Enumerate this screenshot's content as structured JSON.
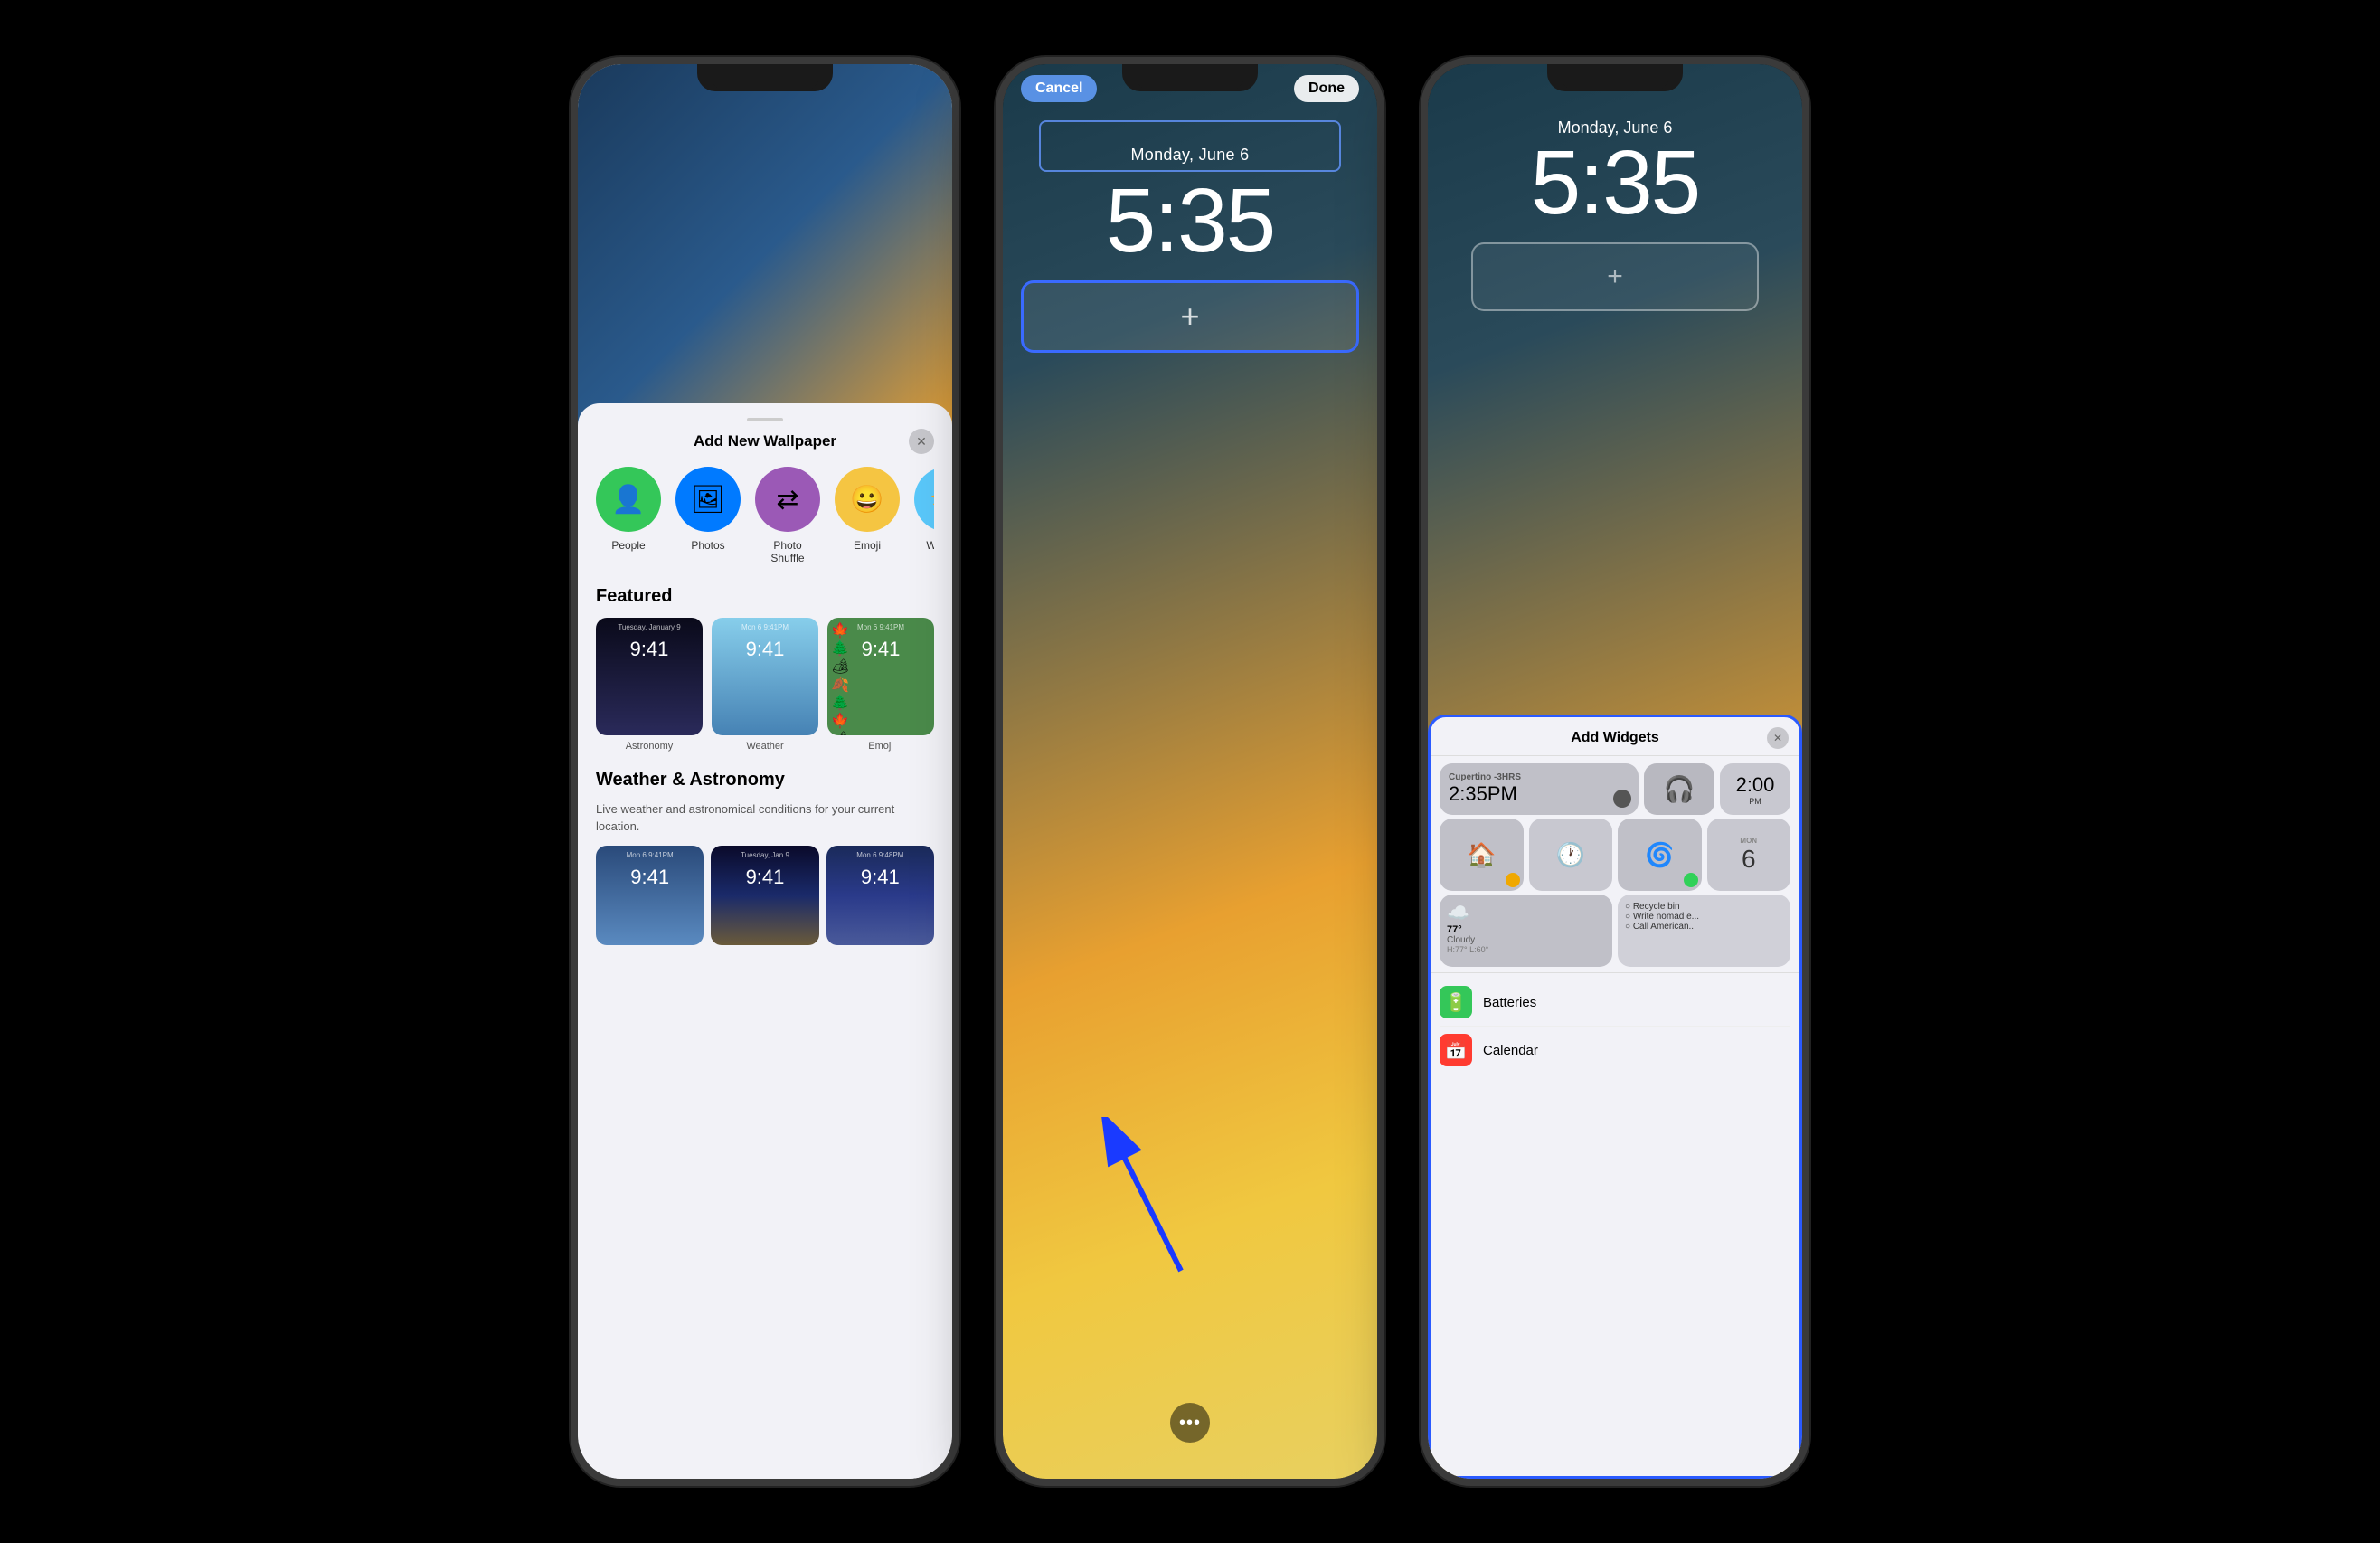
{
  "page": {
    "background": "#000000"
  },
  "phone1": {
    "sheet_title": "Add New Wallpaper",
    "close_button": "✕",
    "wallpaper_types": [
      {
        "id": "people",
        "label": "People",
        "emoji": "👤",
        "color_class": "wt-people"
      },
      {
        "id": "photos",
        "label": "Photos",
        "emoji": "🖼",
        "color_class": "wt-photos"
      },
      {
        "id": "photo_shuffle",
        "label": "Photo Shuffle",
        "emoji": "⇄",
        "color_class": "wt-photoshuffle"
      },
      {
        "id": "emoji",
        "label": "Emoji",
        "emoji": "😀",
        "color_class": "wt-emoji"
      },
      {
        "id": "weather",
        "label": "Weather",
        "emoji": "⛅",
        "color_class": "wt-weather"
      }
    ],
    "featured_label": "Featured",
    "featured_items": [
      {
        "label": "Astronomy",
        "time_text": "Tuesday, January 9",
        "clock": "9:41"
      },
      {
        "label": "Weather",
        "time_text": "Mon 6  9:41PM",
        "clock": "9:41"
      },
      {
        "label": "Emoji",
        "time_text": "Mon 6  9:41PM",
        "clock": "9:41"
      }
    ],
    "weather_section_label": "Weather & Astronomy",
    "weather_section_desc": "Live weather and astronomical conditions for your current location.",
    "weather_thumbs": [
      {
        "time": "Mon 6  9:41PM",
        "clock": "9:41"
      },
      {
        "time": "Tuesday, January 9",
        "clock": "9:41"
      },
      {
        "time": "Mon 6  9:48PM",
        "clock": "9:41"
      }
    ]
  },
  "phone2": {
    "cancel_label": "Cancel",
    "done_label": "Done",
    "date": "Monday, June 6",
    "time": "5:35",
    "plus_icon": "+",
    "dots": "•••"
  },
  "phone3": {
    "date": "Monday, June 6",
    "time": "5:35",
    "plus_icon": "+",
    "add_widgets_title": "Add Widgets",
    "close_button": "✕",
    "widget_weather_location": "Cupertino -3HRS",
    "widget_weather_time_label": "2:35PM",
    "widget_weather_temp": "77°",
    "widget_weather_condition": "Cloudy",
    "widget_weather_hi_lo": "H:77° L:60°",
    "reminders": [
      "○ Recycle bin",
      "○ Write nomad e...",
      "○ Call American..."
    ],
    "apps": [
      {
        "name": "Batteries",
        "emoji": "🔋",
        "color": "app-batteries"
      },
      {
        "name": "Calendar",
        "emoji": "📅",
        "color": "app-calendar"
      }
    ]
  }
}
